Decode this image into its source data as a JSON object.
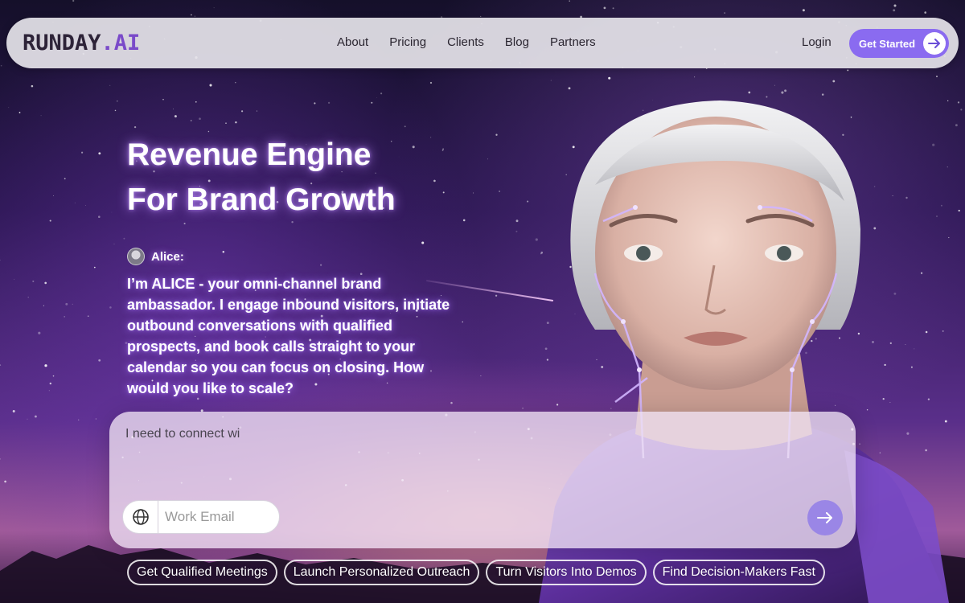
{
  "brand": {
    "logo_part1": "RUNDAY",
    "logo_part2": ".AI",
    "accent": "#8a6bf0",
    "logo_accent": "#7a4ac9"
  },
  "nav": {
    "links": [
      "About",
      "Pricing",
      "Clients",
      "Blog",
      "Partners"
    ],
    "login": "Login",
    "cta": "Get Started",
    "cta_icon": "arrow-right-icon"
  },
  "hero": {
    "headline_line1": "Revenue Engine",
    "headline_line2": "For Brand Growth",
    "speaker": "Alice:",
    "intro": "I’m ALICE - your omni-channel brand ambassador. I engage inbound visitors, initiate outbound conversations with qualified prospects, and book calls straight to your calendar so you can focus on closing. How would you like to scale?"
  },
  "chat": {
    "typed_text": "I need to connect wi",
    "email_placeholder": "Work Email",
    "email_icon": "globe-icon",
    "send_icon": "arrow-right-icon"
  },
  "suggestions": [
    "Get Qualified Meetings",
    "Launch Personalized Outreach",
    "Turn Visitors Into Demos",
    "Find Decision-Makers Fast"
  ]
}
